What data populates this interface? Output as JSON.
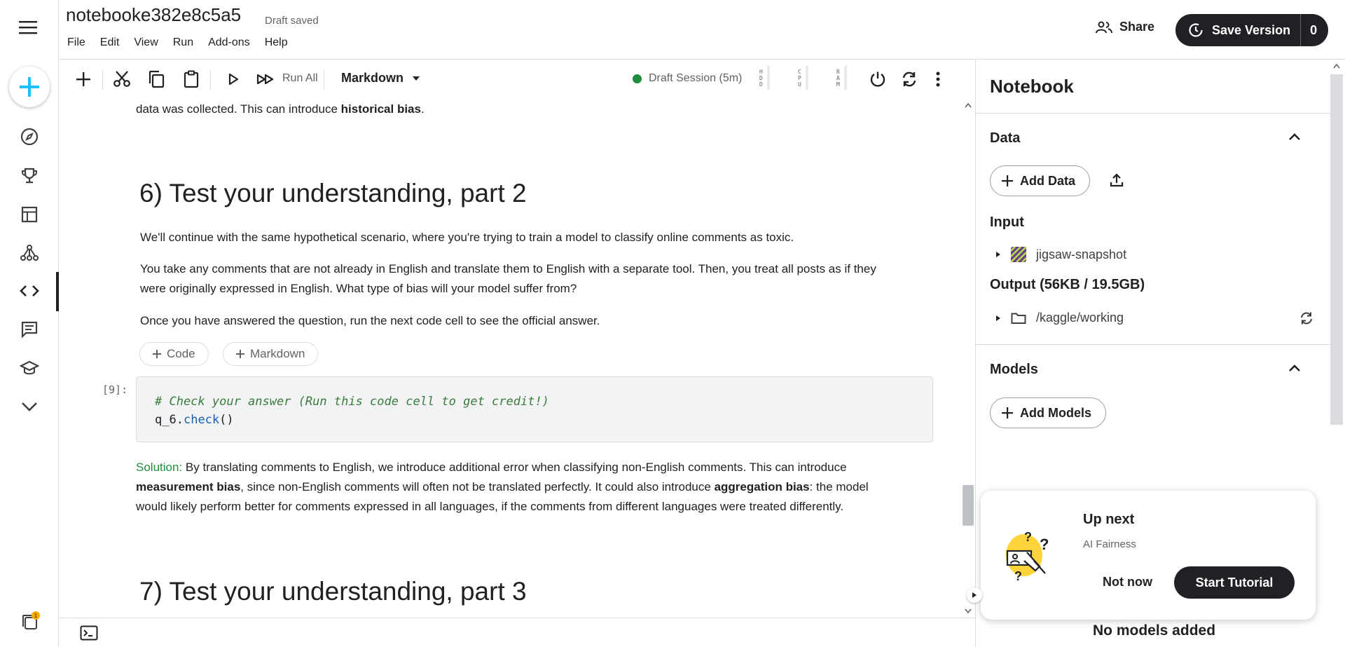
{
  "header": {
    "notebook_title": "notebooke382e8c5a5",
    "save_status": "Draft saved",
    "menu": [
      "File",
      "Edit",
      "View",
      "Run",
      "Add-ons",
      "Help"
    ],
    "share_label": "Share",
    "save_version_label": "Save Version",
    "version_count": "0"
  },
  "toolbar": {
    "run_all_label": "Run All",
    "cell_type": "Markdown",
    "session_label": "Draft Session (5m)",
    "meters": [
      "HDD",
      "CPU",
      "RAM"
    ]
  },
  "notebook": {
    "prev_text_plain": "data was collected. This can introduce ",
    "prev_text_bold": "historical bias",
    "prev_text_end": ".",
    "section6_title": "6) Test your understanding, part 2",
    "para1": "We'll continue with the same hypothetical scenario, where you're trying to train a model to classify online comments as toxic.",
    "para2_line1": "You take any comments that are not already in English and translate them to English with a separate tool. Then, you treat all posts as if they",
    "para2_line2": "were originally expressed in English. What type of bias will your model suffer from?",
    "para3": "Once you have answered the question, run the next code cell to see the official answer.",
    "add_code_label": "Code",
    "add_markdown_label": "Markdown",
    "exec_count": "[9]:",
    "code_comment": "# Check your answer (Run this code cell to get credit!)",
    "code_obj": "q_6",
    "code_dot": ".",
    "code_method": "check",
    "code_parens": "()",
    "solution_label": "Solution:",
    "solution_line1": " By translating comments to English, we introduce additional error when classifying non-English comments. This can introduce",
    "solution_bold1": "measurement bias",
    "solution_line2": ", since non-English comments will often not be translated perfectly. It could also introduce ",
    "solution_bold2": "aggregation bias",
    "solution_line2_end": ": the model",
    "solution_line3": "would likely perform better for comments expressed in all languages, if the comments from different languages were treated differently.",
    "section7_title": "7) Test your understanding, part 3"
  },
  "panel": {
    "title": "Notebook",
    "data_heading": "Data",
    "add_data_label": "Add Data",
    "input_heading": "Input",
    "input_dataset": "jigsaw-snapshot",
    "output_heading": "Output (56KB / 19.5GB)",
    "output_path": "/kaggle/working",
    "models_heading": "Models",
    "add_models_label": "Add Models",
    "no_models": "No models added"
  },
  "upnext": {
    "heading": "Up next",
    "course": "AI Fairness",
    "not_now_label": "Not now",
    "start_label": "Start Tutorial"
  },
  "colors": {
    "accent_blue": "#20beff",
    "solution_green": "#1e8e3e",
    "code_comment_green": "#3d7a3d",
    "method_blue": "#1a5fb4",
    "dark": "#202124"
  }
}
